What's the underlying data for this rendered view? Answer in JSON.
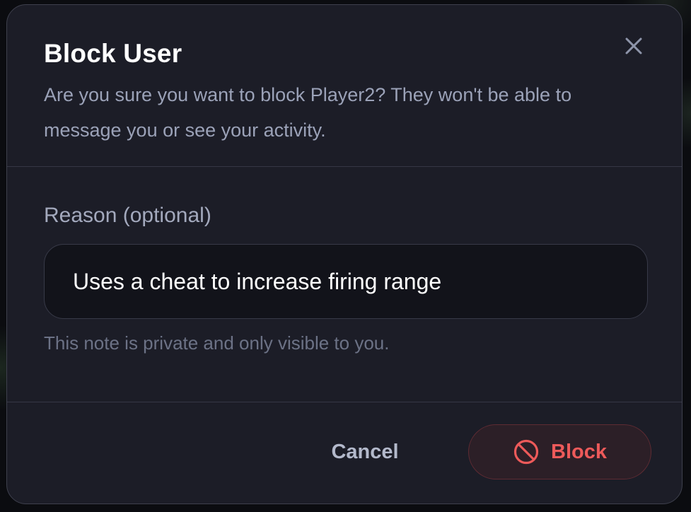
{
  "dialog": {
    "title": "Block User",
    "description": "Are you sure you want to block Player2? They won't be able to message you or see your activity.",
    "close_icon": "close-icon"
  },
  "form": {
    "reason_label": "Reason (optional)",
    "reason_value": "Uses a cheat to increase firing range",
    "helper_text": "This note is private and only visible to you."
  },
  "actions": {
    "cancel_label": "Cancel",
    "block_label": "Block",
    "block_icon": "block-icon"
  },
  "colors": {
    "dialog_bg": "#1c1d27",
    "danger": "#ed5a5a",
    "muted_text": "#9ba2b8"
  }
}
